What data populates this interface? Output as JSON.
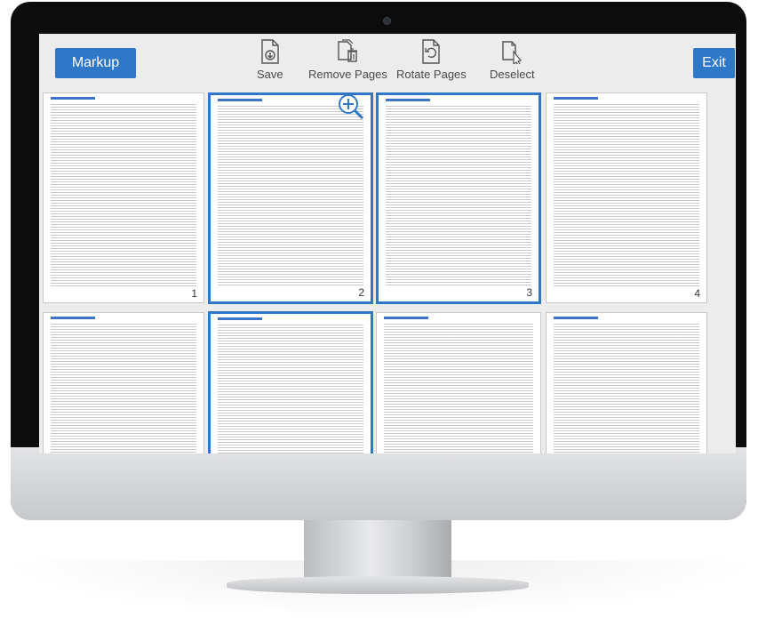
{
  "toolbar": {
    "markup_label": "Markup",
    "exit_label": "Exit",
    "tools": [
      {
        "label": "Save",
        "icon": "save-icon"
      },
      {
        "label": "Remove Pages",
        "icon": "remove-pages-icon"
      },
      {
        "label": "Rotate Pages",
        "icon": "rotate-pages-icon"
      },
      {
        "label": "Deselect",
        "icon": "deselect-icon"
      }
    ]
  },
  "pages": [
    {
      "number": "1",
      "selected": false
    },
    {
      "number": "2",
      "selected": true
    },
    {
      "number": "3",
      "selected": true
    },
    {
      "number": "4",
      "selected": false
    },
    {
      "number": "",
      "selected": false
    },
    {
      "number": "",
      "selected": true
    },
    {
      "number": "",
      "selected": false
    },
    {
      "number": "",
      "selected": false
    }
  ],
  "colors": {
    "accent": "#2f78c8",
    "selection_border": "#2f78c8"
  }
}
